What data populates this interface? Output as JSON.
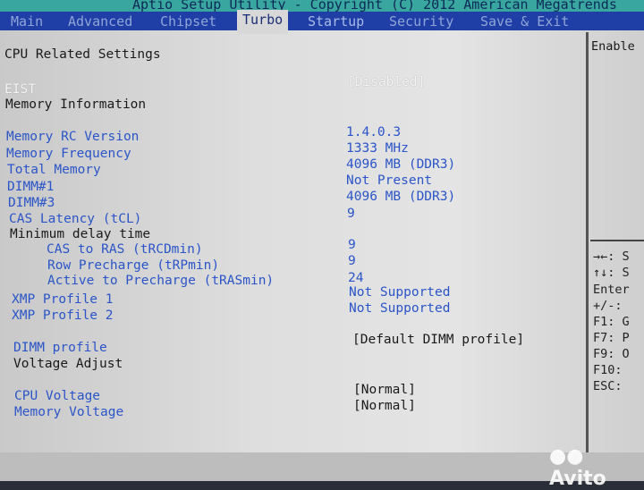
{
  "title": "Aptio Setup Utility - Copyright (C) 2012 American Megatrends",
  "tabs": [
    "Main",
    "Advanced",
    "Chipset",
    "Turbo",
    "Startup",
    "Security",
    "Save & Exit"
  ],
  "active_tab": "Turbo",
  "main": {
    "section": "CPU Related Settings",
    "eist": {
      "label": "EIST",
      "value": "[Disabled]"
    },
    "mem_info": "Memory Information",
    "rows": [
      {
        "label": "Memory RC Version",
        "value": "1.4.0.3"
      },
      {
        "label": "Memory Frequency",
        "value": "1333 MHz"
      },
      {
        "label": "Total Memory",
        "value": "4096 MB (DDR3)"
      },
      {
        "label": "DIMM#1",
        "value": "Not Present"
      },
      {
        "label": "DIMM#3",
        "value": "4096 MB (DDR3)"
      },
      {
        "label": "CAS Latency (tCL)",
        "value": "9"
      }
    ],
    "min_delay": "Minimum delay time",
    "delays": [
      {
        "label": "CAS to RAS (tRCDmin)",
        "value": "9"
      },
      {
        "label": "Row Precharge (tRPmin)",
        "value": "9"
      },
      {
        "label": "Active to Precharge (tRASmin)",
        "value": "24"
      }
    ],
    "xmp": [
      {
        "label": "XMP Profile 1",
        "value": "Not Supported"
      },
      {
        "label": "XMP Profile 2",
        "value": "Not Supported"
      }
    ],
    "dimm_profile": {
      "label": "DIMM profile",
      "value": "[Default DIMM profile]"
    },
    "voltage_adjust": "Voltage Adjust",
    "cpu_voltage": {
      "label": "CPU Voltage",
      "value": "[Normal]"
    },
    "memory_voltage": {
      "label": "Memory Voltage",
      "value": "[Normal]"
    }
  },
  "help": {
    "text": "Enable",
    "keys": [
      "→←: S",
      "↑↓: S",
      "Enter",
      "+/-: ",
      "F1: G",
      "F7: P",
      "F9: O",
      "F10: ",
      "ESC: "
    ]
  },
  "watermark": "Avito",
  "colors": {
    "tab_bar": "#1f3ea6",
    "item_blue": "#2b55c8",
    "title_bar": "#3aa6a0"
  }
}
